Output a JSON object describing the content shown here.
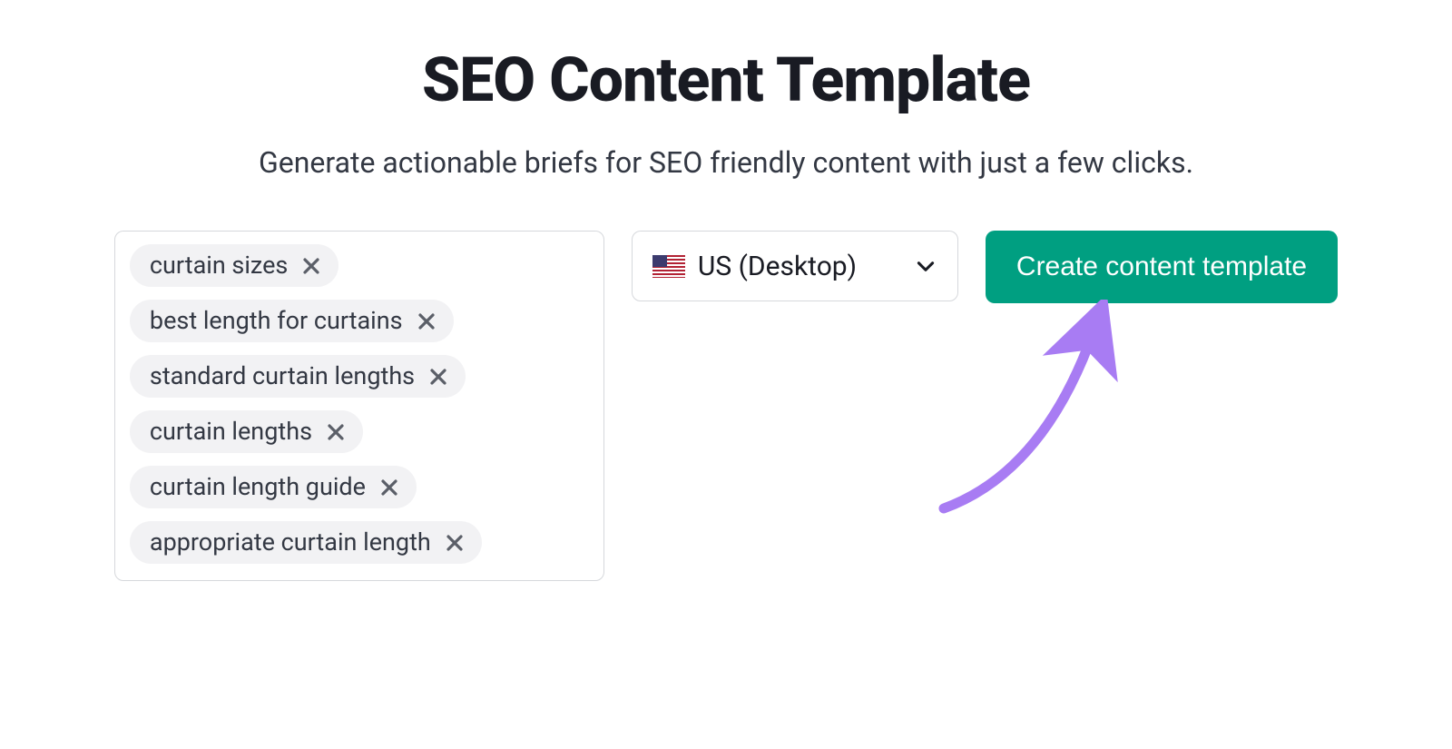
{
  "header": {
    "title": "SEO Content Template",
    "subtitle": "Generate actionable briefs for SEO friendly content with just a few clicks."
  },
  "keywords": [
    "curtain sizes",
    "best length for curtains",
    "standard curtain lengths",
    "curtain lengths",
    "curtain length guide",
    "appropriate curtain length"
  ],
  "region": {
    "label": "US (Desktop)"
  },
  "actions": {
    "create_label": "Create content template"
  },
  "colors": {
    "primary": "#009f81",
    "chip_bg": "#f2f2f4",
    "arrow": "#a87cf3"
  }
}
